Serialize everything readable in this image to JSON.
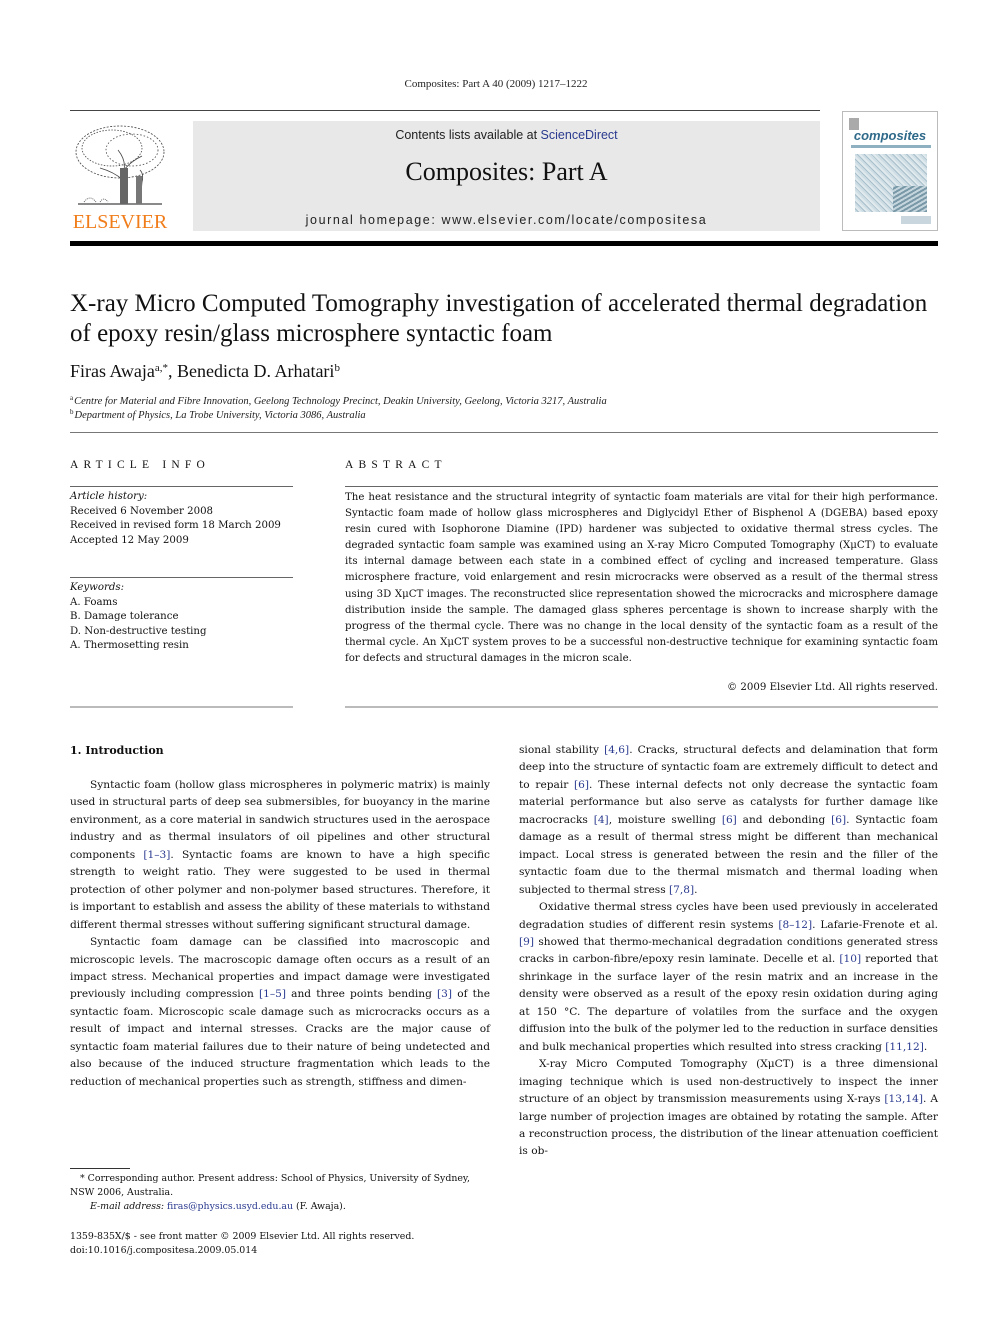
{
  "header": {
    "running_head": "Composites: Part A 40 (2009) 1217–1222",
    "publisher_logo_text": "ELSEVIER",
    "contents_prefix": "Contents lists available at ",
    "contents_link": "ScienceDirect",
    "journal_title": "Composites: Part A",
    "homepage": "journal homepage: www.elsevier.com/locate/compositesa",
    "cover_title": "composites",
    "brand_color": "#f07d1a",
    "link_color": "#2a3a8f"
  },
  "article": {
    "title": "X-ray Micro Computed Tomography investigation of accelerated thermal degradation of epoxy resin/glass microsphere syntactic foam",
    "authors": [
      {
        "name": "Firas Awaja",
        "sup": "a,*"
      },
      {
        "name": "Benedicta D. Arhatari",
        "sup": "b"
      }
    ],
    "author_separator": ", ",
    "affiliations": [
      {
        "mark": "a",
        "text": "Centre for Material and Fibre Innovation, Geelong Technology Precinct, Deakin University, Geelong, Victoria 3217, Australia"
      },
      {
        "mark": "b",
        "text": "Department of Physics, La Trobe University, Victoria 3086, Australia"
      }
    ]
  },
  "article_info": {
    "heading": "ARTICLE INFO",
    "history_label": "Article history:",
    "history": [
      "Received 6 November 2008",
      "Received in revised form 18 March 2009",
      "Accepted 12 May 2009"
    ],
    "keywords_label": "Keywords:",
    "keywords": [
      "A. Foams",
      "B. Damage tolerance",
      "D. Non-destructive testing",
      "A. Thermosetting resin"
    ]
  },
  "abstract": {
    "heading": "ABSTRACT",
    "text": "The heat resistance and the structural integrity of syntactic foam materials are vital for their high performance. Syntactic foam made of hollow glass microspheres and Diglycidyl Ether of Bisphenol A (DGEBA) based epoxy resin cured with Isophorone Diamine (IPD) hardener was subjected to oxidative thermal stress cycles. The degraded syntactic foam sample was examined using an X-ray Micro Computed Tomography (XμCT) to evaluate its internal damage between each state in a combined effect of cycling and increased temperature. Glass microsphere fracture, void enlargement and resin microcracks were observed as a result of the thermal stress using 3D XμCT images. The reconstructed slice representation showed the microcracks and microsphere damage distribution inside the sample. The damaged glass spheres percentage is shown to increase sharply with the progress of the thermal cycle. There was no change in the local density of the syntactic foam as a result of the thermal cycle. An XμCT system proves to be a successful non-destructive technique for examining syntactic foam for defects and structural damages in the micron scale.",
    "copyright": "© 2009 Elsevier Ltd. All rights reserved."
  },
  "body": {
    "section_heading": "1. Introduction",
    "left_column": [
      {
        "indent": true,
        "parts": [
          {
            "t": "Syntactic foam (hollow glass microspheres in polymeric matrix) is mainly used in structural parts of deep sea submersibles, for buoyancy in the marine environment, as a core material in sandwich structures used in the aerospace industry and as thermal insulators of oil pipelines and other structural components "
          },
          {
            "ref": "[1–3]"
          },
          {
            "t": ". Syntactic foams are known to have a high specific strength to weight ratio. They were suggested to be used in thermal protection of other polymer and non-polymer based structures. Therefore, it is important to establish and assess the ability of these materials to withstand different thermal stresses without suffering significant structural damage."
          }
        ]
      },
      {
        "indent": true,
        "parts": [
          {
            "t": "Syntactic foam damage can be classified into macroscopic and microscopic levels. The macroscopic damage often occurs as a result of an impact stress. Mechanical properties and impact damage were investigated previously including compression "
          },
          {
            "ref": "[1–5]"
          },
          {
            "t": " and three points bending "
          },
          {
            "ref": "[3]"
          },
          {
            "t": " of the syntactic foam. Microscopic scale damage such as microcracks occurs as a result of impact and internal stresses. Cracks are the major cause of syntactic foam material failures due to their nature of being undetected and also because of the induced structure fragmentation which leads to the reduction of mechanical properties such as strength, stiffness and dimen-"
          }
        ]
      }
    ],
    "right_column": [
      {
        "indent": false,
        "parts": [
          {
            "t": "sional stability "
          },
          {
            "ref": "[4,6]"
          },
          {
            "t": ". Cracks, structural defects and delamination that form deep into the structure of syntactic foam are extremely difficult to detect and to repair "
          },
          {
            "ref": "[6]"
          },
          {
            "t": ". These internal defects not only decrease the syntactic foam material performance but also serve as catalysts for further damage like macrocracks "
          },
          {
            "ref": "[4]"
          },
          {
            "t": ", moisture swelling "
          },
          {
            "ref": "[6]"
          },
          {
            "t": " and debonding "
          },
          {
            "ref": "[6]"
          },
          {
            "t": ". Syntactic foam damage as a result of thermal stress might be different than mechanical impact. Local stress is generated between the resin and the filler of the syntactic foam due to the thermal mismatch and thermal loading when subjected to thermal stress "
          },
          {
            "ref": "[7,8]"
          },
          {
            "t": "."
          }
        ]
      },
      {
        "indent": true,
        "parts": [
          {
            "t": "Oxidative thermal stress cycles have been used previously in accelerated degradation studies of different resin systems "
          },
          {
            "ref": "[8–12]"
          },
          {
            "t": ". Lafarie-Frenote et al. "
          },
          {
            "ref": "[9]"
          },
          {
            "t": " showed that thermo-mechanical degradation conditions generated stress cracks in carbon-fibre/epoxy resin laminate. Decelle et al. "
          },
          {
            "ref": "[10]"
          },
          {
            "t": " reported that shrinkage in the surface layer of the resin matrix and an increase in the density were observed as a result of the epoxy resin oxidation during aging at 150 °C. The departure of volatiles from the surface and the oxygen diffusion into the bulk of the polymer led to the reduction in surface densities and bulk mechanical properties which resulted into stress cracking "
          },
          {
            "ref": "[11,12]"
          },
          {
            "t": "."
          }
        ]
      },
      {
        "indent": true,
        "parts": [
          {
            "t": "X-ray Micro Computed Tomography (XμCT) is a three dimensional imaging technique which is used non-destructively to inspect the inner structure of an object by transmission measurements using X-rays "
          },
          {
            "ref": "[13,14]"
          },
          {
            "t": ". A large number of projection images are obtained by rotating the sample. After a reconstruction process, the distribution of the linear attenuation coefficient is ob-"
          }
        ]
      }
    ]
  },
  "footnotes": {
    "corresponding": "* Corresponding author. Present address: School of Physics, University of Sydney, NSW 2006, Australia.",
    "email_label": "E-mail address: ",
    "email": "firas@physics.usyd.edu.au",
    "email_suffix": " (F. Awaja).",
    "issn_line": "1359-835X/$ - see front matter © 2009 Elsevier Ltd. All rights reserved.",
    "doi": "doi:10.1016/j.compositesa.2009.05.014"
  }
}
